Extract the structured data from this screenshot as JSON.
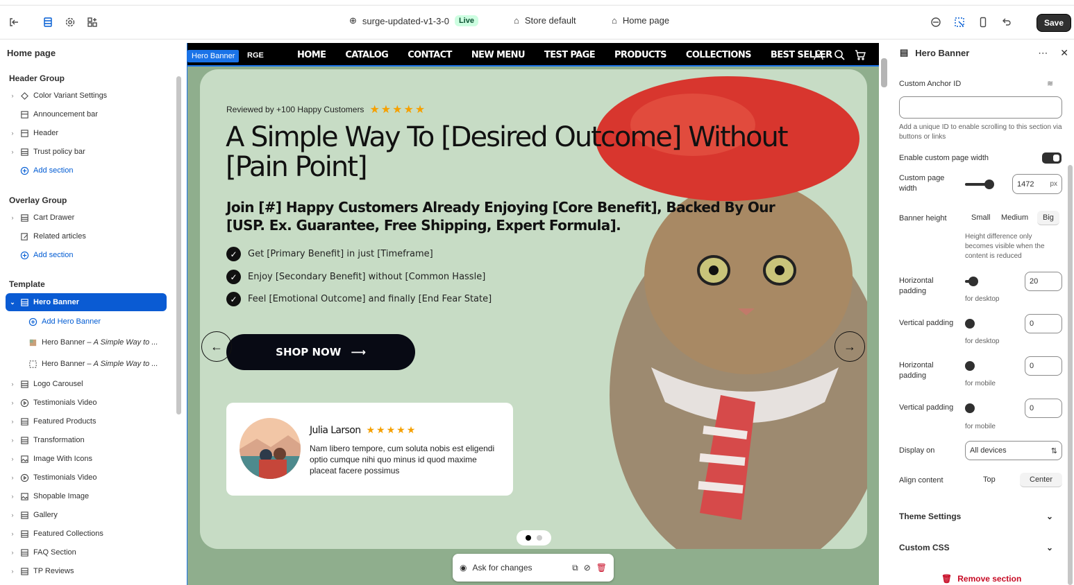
{
  "topbar": {
    "theme_name": "surge-updated-v1-3-0",
    "live_badge": "Live",
    "store": "Store default",
    "page": "Home page",
    "save_label": "Save"
  },
  "sidebar": {
    "title": "Home page",
    "header_group": "Header Group",
    "header_items": [
      "Color Variant Settings",
      "Announcement bar",
      "Header",
      "Trust policy bar"
    ],
    "add_section": "Add section",
    "overlay_group": "Overlay Group",
    "overlay_items": [
      "Cart Drawer",
      "Related articles"
    ],
    "template": "Template",
    "selected": "Hero Banner",
    "add_hero": "Add Hero Banner",
    "hero_block_prefix": "Hero Banner – ",
    "hero_block_title": "A Simple Way to ...",
    "template_items": [
      "Logo Carousel",
      "Testimonials Video",
      "Featured Products",
      "Transformation",
      "Image With Icons",
      "Testimonials Video",
      "Shopable Image",
      "Gallery",
      "Featured Collections",
      "FAQ Section",
      "TP Reviews"
    ]
  },
  "preview": {
    "section_tag": "Hero Banner",
    "logo_partial": "RGE",
    "nav": [
      "HOME",
      "CATALOG",
      "CONTACT",
      "NEW MENU",
      "TEST PAGE",
      "PRODUCTS",
      "COLLECTIONS",
      "BEST SELLER"
    ],
    "reviewed": "Reviewed by +100 Happy Customers",
    "stars": "★★★★★",
    "heading": "A Simple Way To [Desired Outcome] Without [Pain Point]",
    "subheading": "Join [#] Happy Customers Already Enjoying [Core Benefit], Backed By Our [USP. Ex. Guarantee, Free Shipping, Expert Formula].",
    "bullets": [
      "Get [Primary Benefit] in just [Timeframe]",
      "Enjoy [Secondary Benefit] without [Common Hassle]",
      "Feel [Emotional Outcome] and finally [End Fear State]"
    ],
    "cta": "SHOP NOW",
    "review_name": "Julia Larson",
    "review_text": "Nam libero tempore, cum soluta nobis est eligendi optio cumque nihi quo minus id quod maxime placeat facere possimus",
    "ask": "Ask for changes"
  },
  "panel": {
    "title": "Hero Banner",
    "anchor_label": "Custom Anchor ID",
    "anchor_value": "",
    "anchor_hint": "Add a unique ID to enable scrolling to this section via buttons or links",
    "custom_width_label": "Enable custom page width",
    "page_width_label": "Custom page width",
    "page_width_value": "1472",
    "page_width_unit": "px",
    "banner_height_label": "Banner height",
    "heights": [
      "Small",
      "Medium",
      "Big"
    ],
    "height_hint": "Height difference only becomes visible when the content is reduced",
    "h_pad_label": "Horizontal padding",
    "h_pad_value": "20",
    "v_pad_label": "Vertical padding",
    "v_pad_value": "0",
    "h_pad_m_value": "0",
    "v_pad_m_value": "0",
    "for_desktop": "for desktop",
    "for_mobile": "for mobile",
    "display_label": "Display on",
    "display_value": "All devices",
    "align_label": "Align content",
    "align_opts": [
      "Top",
      "Center"
    ],
    "theme_settings": "Theme Settings",
    "custom_css": "Custom CSS",
    "remove": "Remove section"
  },
  "colors": {
    "accent": "#005bd3",
    "selected": "#0a5bd3",
    "banner": "#c7dcc5",
    "page_bg": "#8fae8d"
  }
}
